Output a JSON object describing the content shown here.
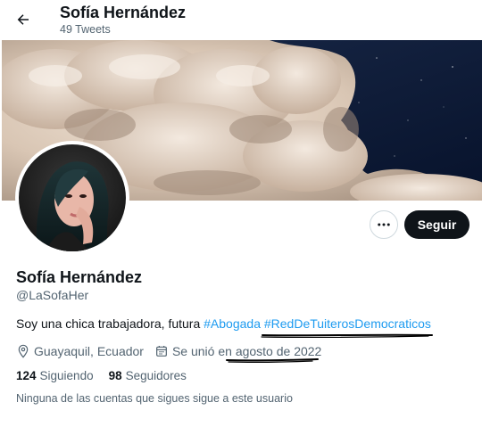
{
  "header": {
    "title": "Sofía Hernández",
    "tweet_count": "49 Tweets",
    "back_icon": "arrow-left-icon"
  },
  "banner": {
    "description_icon": "cloud-sky-banner",
    "colors": {
      "sky": "#0c1a3a",
      "cloud": "#e6d6c6",
      "cloud_shadow": "#a89483"
    }
  },
  "profile": {
    "display_name": "Sofía Hernández",
    "handle": "@LaSofaHer",
    "bio_text": "Soy una chica trabajadora, futura ",
    "bio_hashtags": [
      "#Abogada",
      "#RedDeTuiterosDemocraticos"
    ],
    "location": "Guayaquil, Ecuador",
    "joined_prefix": "Se unió en ",
    "joined_date": "agosto de 2022",
    "following_count": "124",
    "following_label": "Siguiendo",
    "followers_count": "98",
    "followers_label": "Seguidores",
    "mutual_note": "Ninguna de las cuentas que sigues sigue a este usuario"
  },
  "actions": {
    "follow_label": "Seguir",
    "more_icon": "more-dots-icon"
  },
  "colors": {
    "accent": "#1d9bf0",
    "text_primary": "#0f1419",
    "text_secondary": "#536471",
    "button_dark": "#0f1419",
    "annotation": "#000000"
  }
}
